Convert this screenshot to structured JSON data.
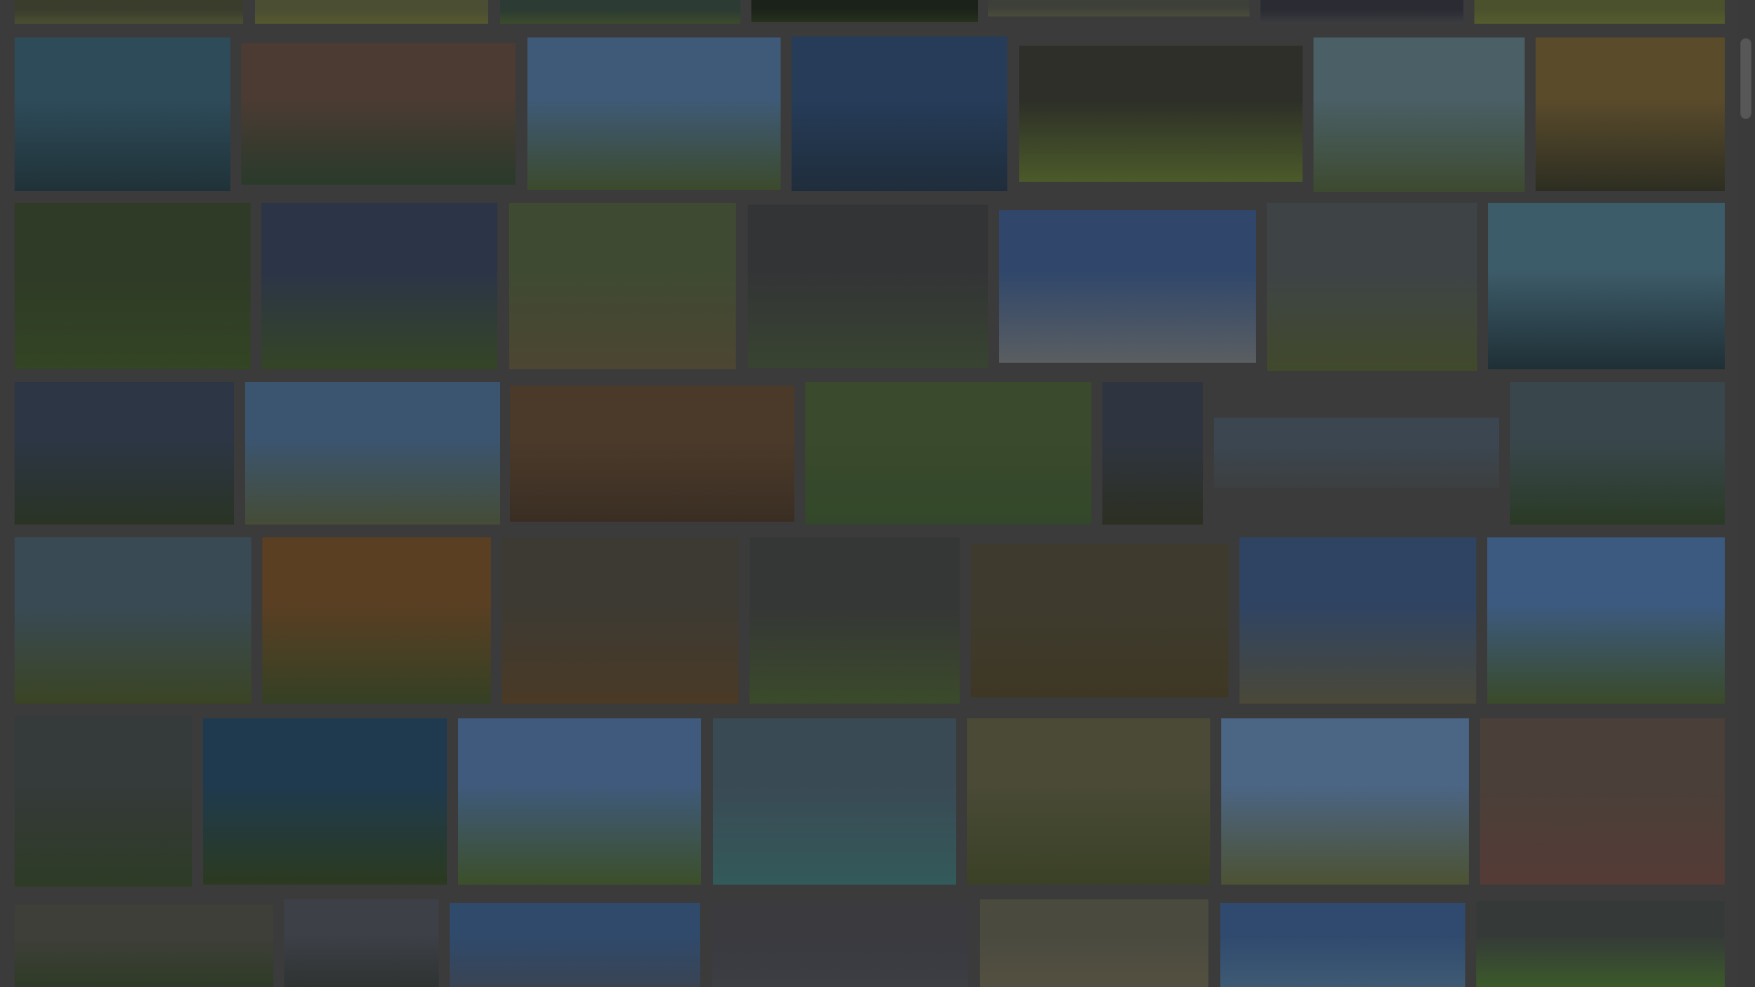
{
  "gallery": {
    "tiles": [
      {
        "name": "tile-r0-1",
        "c1": "#3a3d2c",
        "c2": "#4a4f32"
      },
      {
        "name": "tile-r0-2",
        "c1": "#4b4e33",
        "c2": "#55592f"
      },
      {
        "name": "tile-r0-3",
        "c1": "#2c3b33",
        "c2": "#3b4b2c"
      },
      {
        "name": "tile-r0-4",
        "c1": "#1b2219",
        "c2": "#26301e"
      },
      {
        "name": "tile-r0-5",
        "c1": "#3d3f39",
        "c2": "#4a4d3a"
      },
      {
        "name": "tile-r0-6",
        "c1": "#2b2c33",
        "c2": "#3a3c40"
      },
      {
        "name": "tile-r0-7",
        "c1": "#4b512c",
        "c2": "#565c2e"
      },
      {
        "name": "tile-lake-islands",
        "c1": "#2e4b5a",
        "c2": "#203238"
      },
      {
        "name": "tile-forest-lake-dusk",
        "c1": "#4b3b33",
        "c2": "#2a3a2b"
      },
      {
        "name": "tile-valley-cliffs",
        "c1": "#3e5a78",
        "c2": "#3c4a2c"
      },
      {
        "name": "tile-mountain-lake-reflection",
        "c1": "#263c59",
        "c2": "#1f2d3b"
      },
      {
        "name": "tile-green-hills",
        "c1": "#2d2f28",
        "c2": "#4b5a2a"
      },
      {
        "name": "tile-road-hills",
        "c1": "#4a5f66",
        "c2": "#3d4a30"
      },
      {
        "name": "tile-sunset-trees",
        "c1": "#5a4b2b",
        "c2": "#2d2e22"
      },
      {
        "name": "tile-park-trees",
        "c1": "#2f3a27",
        "c2": "#324524"
      },
      {
        "name": "tile-cloudy-field",
        "c1": "#2c3448",
        "c2": "#344526"
      },
      {
        "name": "tile-marsh-trees",
        "c1": "#3f4a33",
        "c2": "#4c4632"
      },
      {
        "name": "tile-cabin-storm",
        "c1": "#333436",
        "c2": "#384431"
      },
      {
        "name": "tile-boulders-snow",
        "c1": "#30476b",
        "c2": "#5a5e61"
      },
      {
        "name": "tile-alpine-valley",
        "c1": "#3e4446",
        "c2": "#41492c"
      },
      {
        "name": "tile-lake-mountain-mirror",
        "c1": "#3d5c69",
        "c2": "#1f2f36"
      },
      {
        "name": "tile-storm-sky",
        "c1": "#2c3645",
        "c2": "#2a3324"
      },
      {
        "name": "tile-rocky-hillside",
        "c1": "#3b5570",
        "c2": "#454c36"
      },
      {
        "name": "tile-painting-sunset",
        "c1": "#4b3a2a",
        "c2": "#3a2e23"
      },
      {
        "name": "tile-green-slope",
        "c1": "#3a4a2c",
        "c2": "#33472a"
      },
      {
        "name": "tile-tall-forest",
        "c1": "#2f3540",
        "c2": "#2c2f22"
      },
      {
        "name": "tile-panorama-haze",
        "c1": "#3b4650",
        "c2": "#3c3f3f"
      },
      {
        "name": "tile-river-forest",
        "c1": "#39474d",
        "c2": "#2a3a25"
      },
      {
        "name": "tile-spring-trees",
        "c1": "#394a55",
        "c2": "#3a4424"
      },
      {
        "name": "tile-sunset-savanna",
        "c1": "#5a3f23",
        "c2": "#354024"
      },
      {
        "name": "tile-highland-trail",
        "c1": "#3d3a33",
        "c2": "#4a3a26"
      },
      {
        "name": "tile-country-path",
        "c1": "#353636",
        "c2": "#3b4a2b"
      },
      {
        "name": "tile-painting-cattle",
        "c1": "#3e3b2e",
        "c2": "#3e3724"
      },
      {
        "name": "tile-barn-field",
        "c1": "#2f4463",
        "c2": "#4a4838"
      },
      {
        "name": "tile-blue-sky-plain",
        "c1": "#3c5a80",
        "c2": "#3a4a29"
      },
      {
        "name": "tile-mountain-creek",
        "c1": "#353a3a",
        "c2": "#2e3b26"
      },
      {
        "name": "tile-dark-shrubs",
        "c1": "#1f3a4f",
        "c2": "#2b3a1f"
      },
      {
        "name": "tile-reed-river",
        "c1": "#3f5a7c",
        "c2": "#3c4f2a"
      },
      {
        "name": "tile-turquoise-lake",
        "c1": "#3a4a55",
        "c2": "#335a5a"
      },
      {
        "name": "tile-waterfall-woods",
        "c1": "#4a4a36",
        "c2": "#3a4126"
      },
      {
        "name": "tile-alpine-tarn",
        "c1": "#4b6585",
        "c2": "#4c5233"
      },
      {
        "name": "tile-canyon-road",
        "c1": "#4a3f39",
        "c2": "#553b36"
      },
      {
        "name": "tile-r6-1",
        "c1": "#3e3f39",
        "c2": "#2f3b26"
      },
      {
        "name": "tile-r6-2",
        "c1": "#3d4047",
        "c2": "#2f3332"
      },
      {
        "name": "tile-r6-3",
        "c1": "#2f4a6b",
        "c2": "#3a4353"
      },
      {
        "name": "tile-r6-4",
        "c1": "#3a3a3f",
        "c2": "#3c3e44"
      },
      {
        "name": "tile-elephant",
        "c1": "#4a4a3f",
        "c2": "#545041"
      },
      {
        "name": "tile-r6-6",
        "c1": "#2f4a6e",
        "c2": "#3f5a73"
      },
      {
        "name": "tile-r6-7",
        "c1": "#353a38",
        "c2": "#3b5a2a"
      }
    ]
  }
}
